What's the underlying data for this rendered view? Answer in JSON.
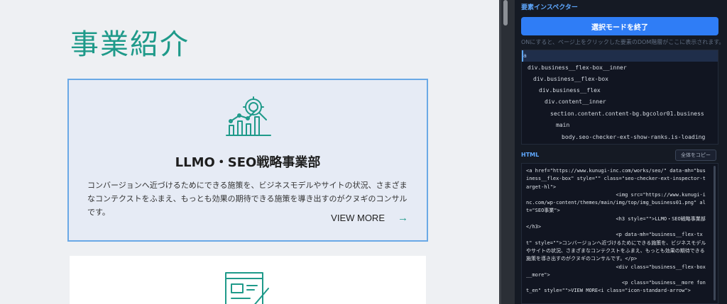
{
  "page": {
    "title": "事業紹介",
    "card1": {
      "heading": "LLMO・SEO戦略事業部",
      "text": "コンバージョンへ近づけるためにできる施策を、ビジネスモデルやサイトの状況、さまざまなコンテクストをふまえ、もっとも効果の期待できる施策を導き出すのがクヌギのコンサルです。",
      "more": "VIEW MORE",
      "arrow": "→",
      "icon": "analytics-chart-icon"
    },
    "card2": {
      "icon": "document-edit-icon"
    },
    "accent": "#1f9a8a",
    "selection_border": "#6aa9e6"
  },
  "inspector": {
    "title": "要素インスペクター",
    "exit_button": "選択モードを終了",
    "hint": "ONにすると、ページ上をクリックした要素のDOM階層がここに表示されます。",
    "tree": [
      "a",
      "div.business__flex-box__inner",
      "div.business__flex-box",
      "div.business__flex",
      "div.content__inner",
      "section.content.content-bg.bgcolor01.business",
      "main",
      "body.seo-checker-ext-show-ranks.is-loading"
    ],
    "html_label": "HTML",
    "copy_button": "全体をコピー",
    "code_lines": [
      "<a href=\"https://www.kunugi-inc.com/works/seo/\" data-mh=\"business__flex-box\" style=\"\" class=\"seo-checker-ext-inspector-target-hl\">",
      "                              <img src=\"https://www.kunugi-inc.com/wp-content/themes/main/img/top/img_business01.png\" alt=\"SEO事業\">",
      "                              <h3 style=\"\">LLMO・SEO戦略事業部</h3>",
      "                              <p data-mh=\"business__flex-txt\" style=\"\">コンバージョンへ近づけるためにできる施策を、ビジネスモデルやサイトの状況、さまざまなコンテクストをふまえ、もっとも効果の期待できる施策を導き出すのがクヌギのコンサルです。</p>",
      "                              <div class=\"business__flex-box__more\">",
      "                                <p class=\"business__more font_en\" style=\"\">VIEW MORE<i class=\"icon-standard-arrow\">"
    ],
    "accent": "#2f7df6"
  }
}
